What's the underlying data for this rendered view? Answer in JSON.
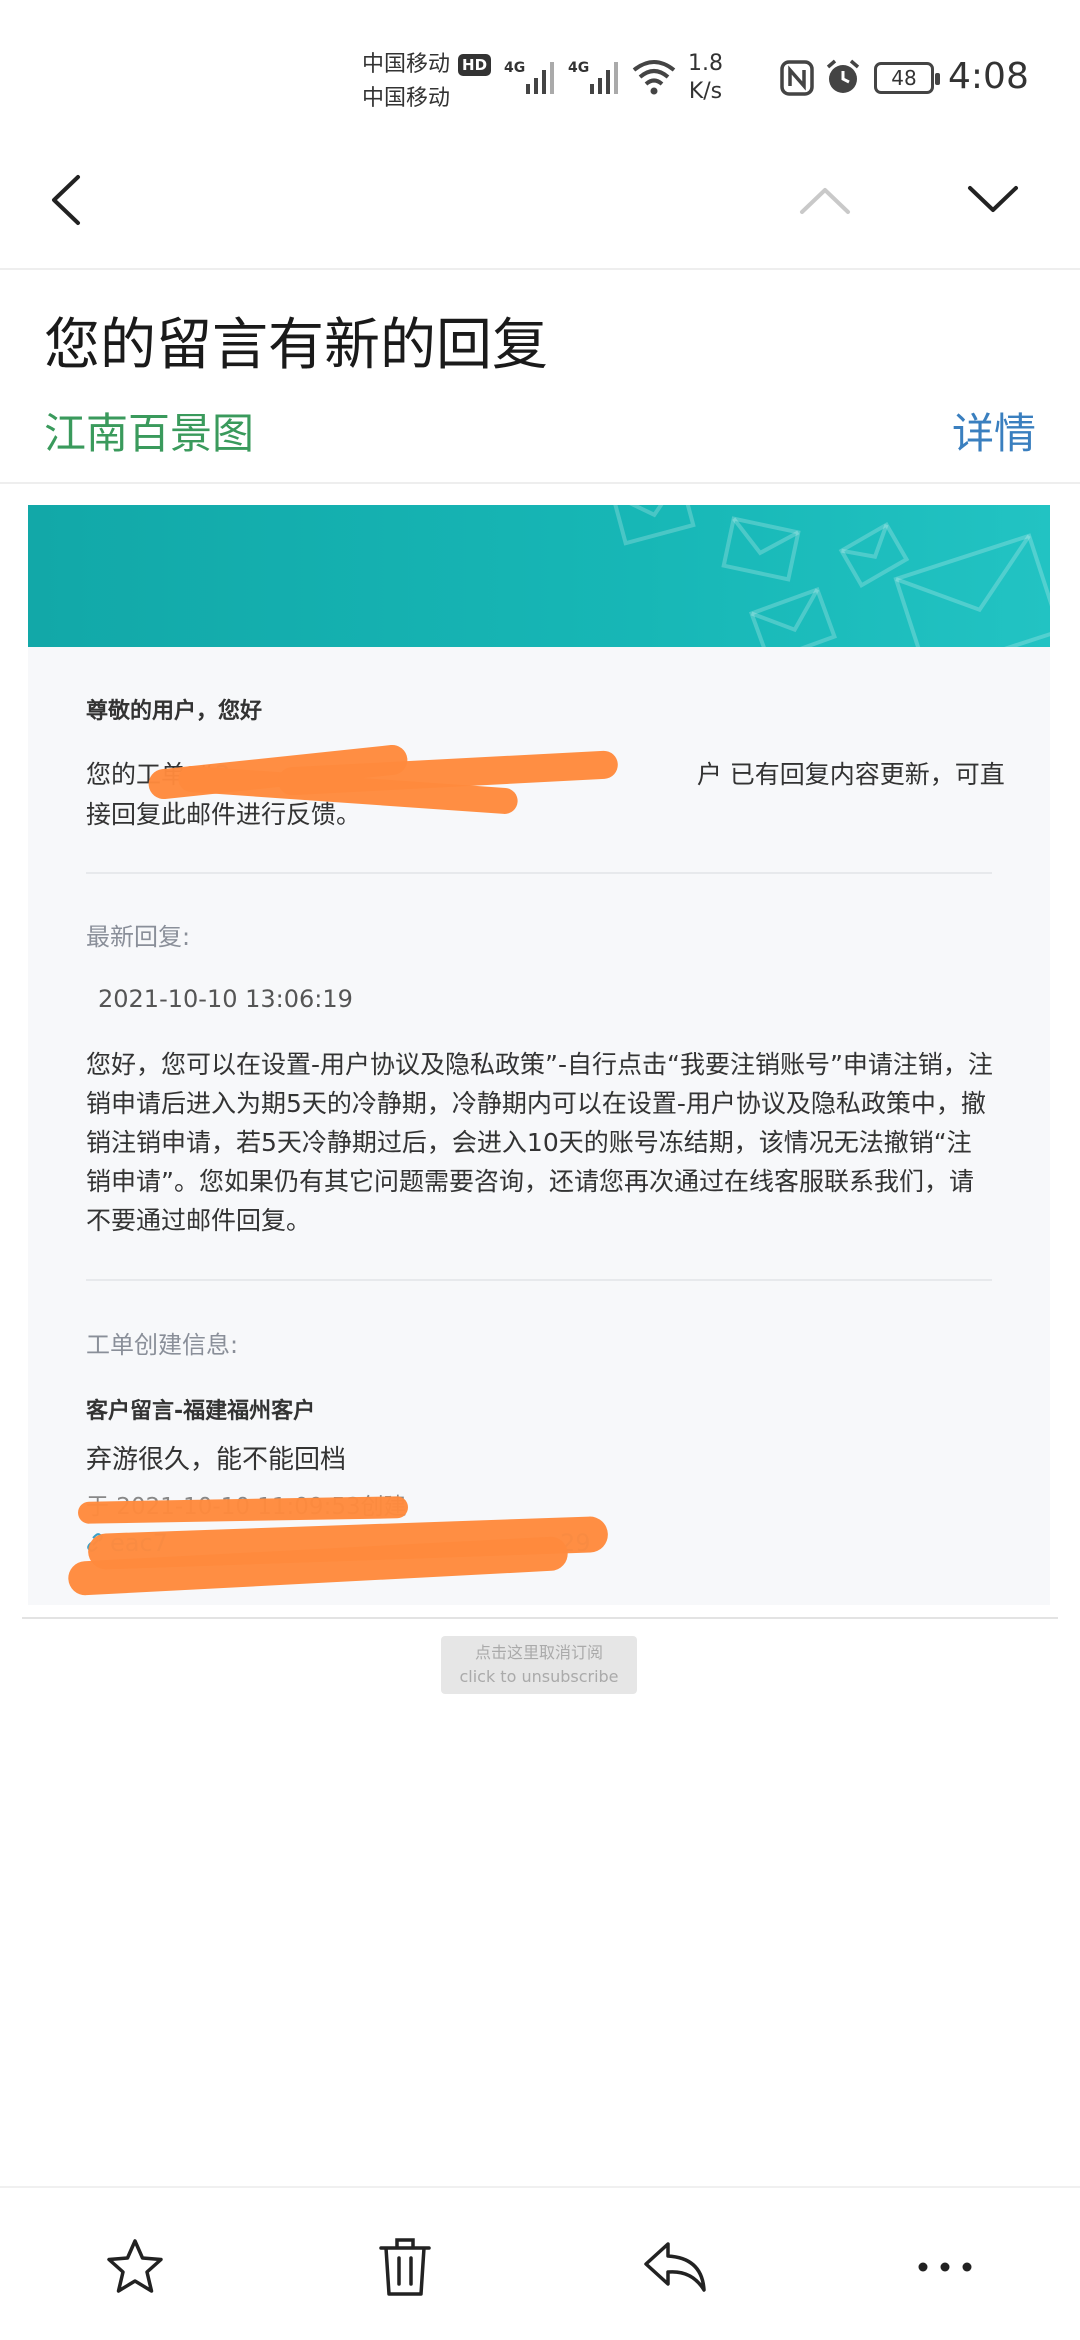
{
  "status_bar": {
    "carrier_1": "中国移动",
    "carrier_1_badge": "HD",
    "carrier_2": "中国移动",
    "network_1": "4G",
    "network_2": "4G",
    "speed_value": "1.8",
    "speed_unit": "K/s",
    "battery": "48",
    "time": "4:08"
  },
  "nav": {
    "back_icon": "chevron-left-icon",
    "prev_icon": "chevron-up-icon",
    "next_icon": "chevron-down-icon"
  },
  "header": {
    "subject": "您的留言有新的回复",
    "sender": "江南百景图",
    "details_label": "详情"
  },
  "email": {
    "greeting": "尊敬的用户，您好",
    "ticket_line": "您的工单 #2                                                   户 已有回复内容更新，可直接回复此邮件进行反馈。",
    "ticket_prefix": "您的工单 #",
    "ticket_suffix": "户 已有回复内容更新，可直接回复此邮件进行反馈。",
    "latest_reply_label": "最新回复:",
    "reply_date": "2021-10-10 13:06:19",
    "reply_body": "您好，您可以在设置-用户协议及隐私政策”-自行点击“我要注销账号”申请注销，注销申请后进入为期5天的冷静期，冷静期内可以在设置-用户协议及隐私政策中，撤销注销申请，若5天冷静期过后，会进入10天的账号冻结期，该情况无法撤销“注销申请”。您如果仍有其它问题需要咨询，还请您再次通过在线客服联系我们，请不要通过邮件回复。",
    "creation_label": "工单创建信息:",
    "creator_title": "客户留言-福建福州客户",
    "creator_message": "弃游很久，能不能回档",
    "created_at": "于 2021-10-10 11:09:53创建",
    "link_text": "eac7",
    "link_tail": "29",
    "unsubscribe_cn": "点击这里取消订阅",
    "unsubscribe_en": "click to unsubscribe"
  },
  "toolbar": {
    "star_icon": "star-icon",
    "delete_icon": "trash-icon",
    "reply_icon": "reply-icon",
    "more_icon": "more-icon"
  },
  "colors": {
    "banner": "#17b7b6",
    "sender": "#3a9a5c",
    "details": "#3a7fbf",
    "redaction": "#ff8a3d"
  }
}
